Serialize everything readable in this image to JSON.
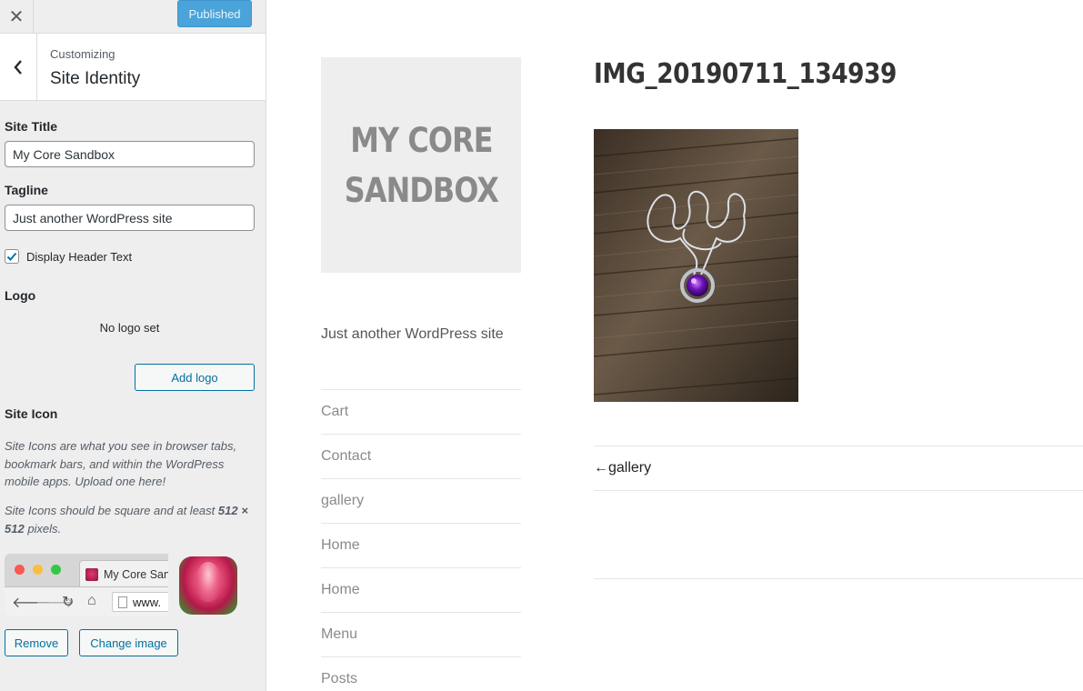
{
  "topbar": {
    "publish_label": "Published",
    "close_icon": "close-icon"
  },
  "section": {
    "breadcrumb": "Customizing",
    "title": "Site Identity"
  },
  "fields": {
    "site_title_label": "Site Title",
    "site_title_value": "My Core Sandbox",
    "tagline_label": "Tagline",
    "tagline_value": "Just another WordPress site",
    "display_header_label": "Display Header Text",
    "display_header_checked": true
  },
  "logo": {
    "label": "Logo",
    "empty_text": "No logo set",
    "add_label": "Add logo"
  },
  "site_icon": {
    "label": "Site Icon",
    "desc1": "Site Icons are what you see in browser tabs, bookmark bars, and within the WordPress mobile apps. Upload one here!",
    "desc2_pre": "Site Icons should be square and at least ",
    "desc2_bold": "512 × 512",
    "desc2_post": " pixels.",
    "browser_tab_text": "My Core Sandbox",
    "browser_url_text": "www.",
    "remove_label": "Remove",
    "change_label": "Change image"
  },
  "preview": {
    "logo_line1": "MY CORE",
    "logo_line2": "SANDBOX",
    "tagline": "Just another WordPress site",
    "menu": [
      "Cart",
      "Contact",
      "gallery",
      "Home",
      "Home",
      "Menu",
      "Posts"
    ],
    "post_title": "IMG_20190711_134939",
    "post_nav": "←gallery"
  },
  "colors": {
    "accent": "#0071a1",
    "publish_bg": "#4aa3d9",
    "sidebar_bg": "#eeeeee"
  }
}
